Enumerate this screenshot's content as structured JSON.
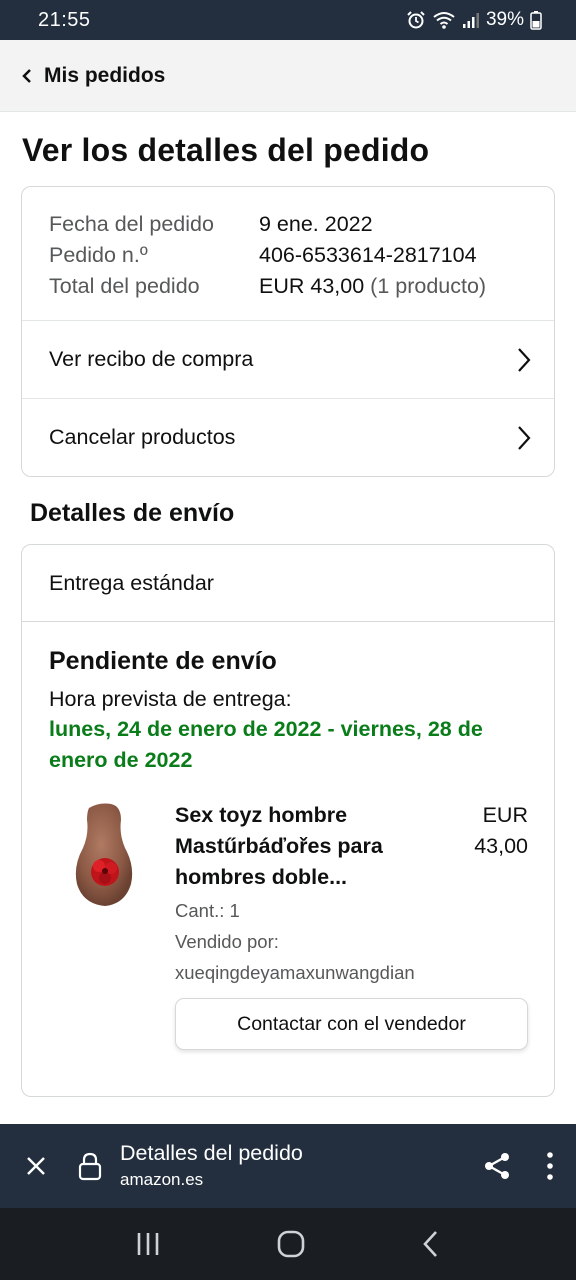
{
  "status_bar": {
    "time": "21:55",
    "battery": "39%"
  },
  "header": {
    "back_label": "Mis pedidos"
  },
  "page_title": "Ver los detalles del pedido",
  "order_summary": {
    "rows": [
      {
        "label": "Fecha del pedido",
        "value": "9 ene. 2022",
        "extra": ""
      },
      {
        "label": "Pedido n.º",
        "value": "406-6533614-2817104",
        "extra": ""
      },
      {
        "label": "Total del pedido",
        "value": "EUR 43,00",
        "extra": "(1 producto)"
      }
    ],
    "links": [
      {
        "label": "Ver recibo de compra"
      },
      {
        "label": "Cancelar productos"
      }
    ]
  },
  "shipping": {
    "section_title": "Detalles de envío",
    "delivery_type": "Entrega estándar",
    "status": "Pendiente de envío",
    "eta_label": "Hora prevista de entrega:",
    "eta_value": "lunes, 24 de enero de 2022 - viernes, 28 de enero de 2022",
    "product": {
      "title": "Sex toyz hombre Mastűrbáďořes para hombres doble...",
      "price": "EUR 43,00",
      "quantity": "Cant.: 1",
      "sold_by_label": "Vendido por:",
      "seller": "xueqingdeyamaxunwangdian",
      "contact_button": "Contactar con el vendedor"
    }
  },
  "browser_bar": {
    "title": "Detalles del pedido",
    "domain": "amazon.es"
  },
  "colors": {
    "status_bar": "#232f3e",
    "eta_green": "#0a7d1a",
    "nav_bar": "#1a1d22"
  },
  "icons": [
    "alarm-icon",
    "wifi-icon",
    "signal-icon",
    "battery-icon",
    "back-chevron-icon",
    "chevron-right-icon",
    "close-icon",
    "lock-icon",
    "share-icon",
    "more-vert-icon",
    "recent-apps-icon",
    "home-icon",
    "back-icon"
  ]
}
